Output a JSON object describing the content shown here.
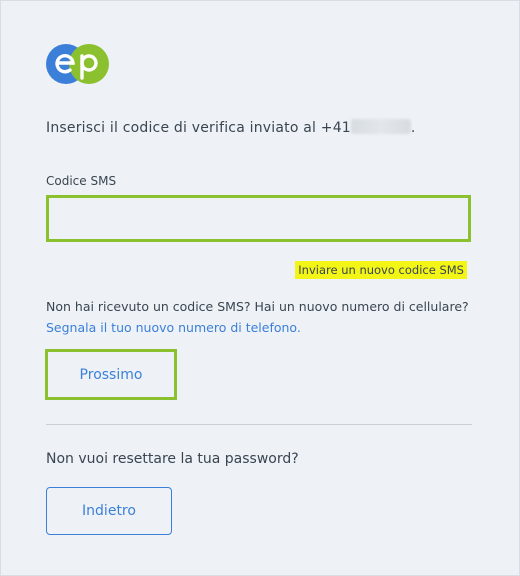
{
  "brand": {
    "logo_text": "ep",
    "colors": {
      "blue": "#3b7fd9",
      "green": "#8bc02e",
      "highlight": "#f2f515"
    }
  },
  "verification": {
    "instruction_prefix": "Inserisci il codice di verifica inviato al +41",
    "instruction_suffix": ".",
    "code_label": "Codice SMS",
    "code_value": "",
    "resend_link": "Inviare un nuovo codice SMS"
  },
  "help": {
    "text": "Non hai ricevuto un codice SMS? Hai un nuovo numero di cellulare?",
    "link": "Segnala il tuo nuovo numero di telefono."
  },
  "actions": {
    "next_label": "Prossimo"
  },
  "reset": {
    "question": "Non vuoi resettare la tua password?",
    "back_label": "Indietro"
  }
}
